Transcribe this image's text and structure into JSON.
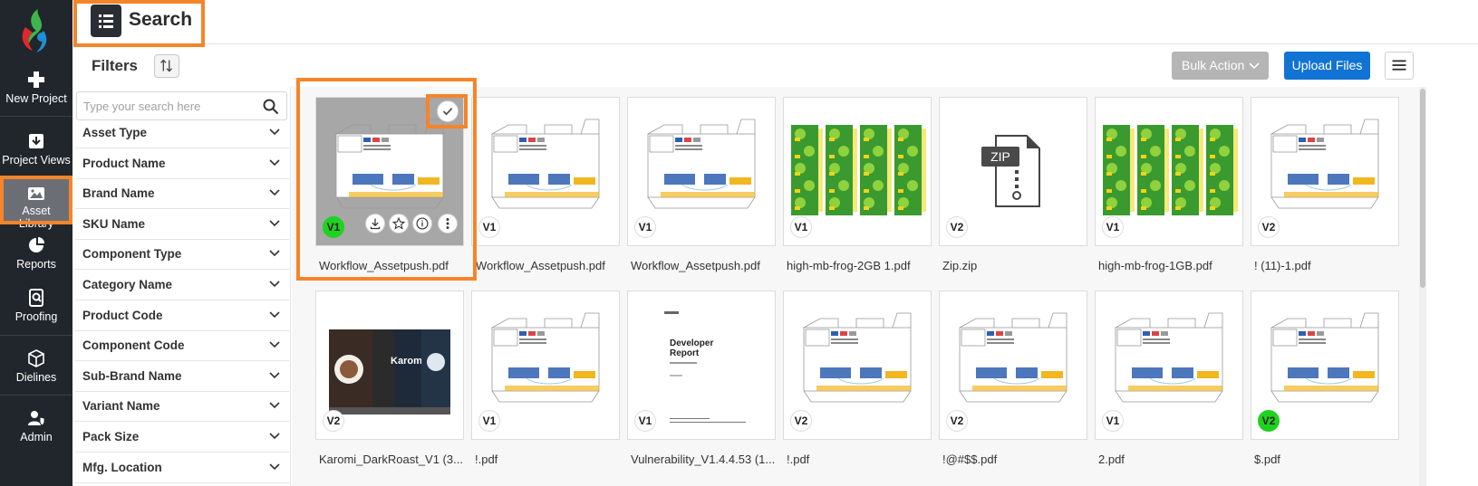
{
  "app": {
    "brand_colors": {
      "nav_bg": "#21262d",
      "accent": "#f5842a",
      "primary": "#1173d4"
    }
  },
  "nav": {
    "items": [
      {
        "label": "New Project",
        "icon": "plus-icon"
      },
      {
        "label": "Project Views",
        "icon": "download-box-icon"
      },
      {
        "label": "Asset Library",
        "icon": "image-icon",
        "active": true
      },
      {
        "label": "Reports",
        "icon": "pie-chart-icon"
      },
      {
        "label": "Proofing",
        "icon": "search-document-icon"
      },
      {
        "label": "Dielines",
        "icon": "cube-icon"
      },
      {
        "label": "Admin",
        "icon": "user-shield-icon"
      }
    ]
  },
  "header": {
    "title": "Search",
    "menu_icon": "list-icon"
  },
  "filters": {
    "title": "Filters",
    "sort_icon": "sort-arrows-icon",
    "search_placeholder": "Type your search here",
    "items": [
      "Asset Type",
      "Product Name",
      "Brand Name",
      "SKU Name",
      "Component Type",
      "Category Name",
      "Product Code",
      "Component Code",
      "Sub-Brand Name",
      "Variant Name",
      "Pack Size",
      "Mfg. Location"
    ]
  },
  "toolbar": {
    "bulk_action": "Bulk Action",
    "upload_files": "Upload Files",
    "list_icon": "hamburger-icon"
  },
  "assets": [
    {
      "name": "Workflow_Assetpush.pdf",
      "version": "V1",
      "thumb": "dieline",
      "selected": true,
      "version_highlight": true
    },
    {
      "name": "Workflow_Assetpush.pdf",
      "version": "V1",
      "thumb": "dieline"
    },
    {
      "name": "Workflow_Assetpush.pdf",
      "version": "V1",
      "thumb": "dieline"
    },
    {
      "name": "high-mb-frog-2GB 1.pdf",
      "version": "V1",
      "thumb": "frog"
    },
    {
      "name": "Zip.zip",
      "version": "V2",
      "thumb": "zip"
    },
    {
      "name": "high-mb-frog-1GB.pdf",
      "version": "V1",
      "thumb": "frog"
    },
    {
      "name": "! (11)-1.pdf",
      "version": "V2",
      "thumb": "dieline"
    },
    {
      "name": "Karomi_DarkRoast_V1 (3...",
      "version": "V2",
      "thumb": "coffee"
    },
    {
      "name": "!.pdf",
      "version": "V1",
      "thumb": "dieline"
    },
    {
      "name": "Vulnerability_V1.4.4.53 (1...",
      "version": "V1",
      "thumb": "report"
    },
    {
      "name": "!.pdf",
      "version": "V2",
      "thumb": "dieline"
    },
    {
      "name": "!@#$$.pdf",
      "version": "V2",
      "thumb": "dieline"
    },
    {
      "name": "2.pdf",
      "version": "V1",
      "thumb": "dieline"
    },
    {
      "name": "$.pdf",
      "version": "V2",
      "thumb": "dieline",
      "version_highlight": true
    }
  ],
  "thumb_text": {
    "zip_label": "ZIP",
    "report_title_1": "Developer",
    "report_title_2": "Report",
    "coffee_brand": "Karomi"
  },
  "card_actions": [
    "download-icon",
    "star-icon",
    "info-icon",
    "more-vertical-icon"
  ]
}
